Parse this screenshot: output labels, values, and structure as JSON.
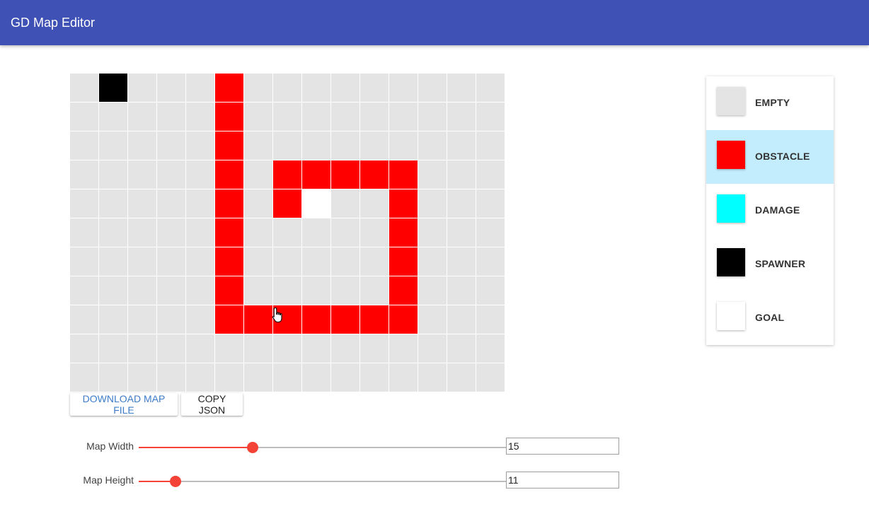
{
  "app": {
    "title": "GD Map Editor"
  },
  "tile_types": {
    "E": {
      "name": "EMPTY",
      "color": "#e4e4e4"
    },
    "O": {
      "name": "OBSTACLE",
      "color": "#ff0000"
    },
    "D": {
      "name": "DAMAGE",
      "color": "#00ffff"
    },
    "S": {
      "name": "SPAWNER",
      "color": "#000000"
    },
    "G": {
      "name": "GOAL",
      "color": "#ffffff"
    }
  },
  "map": {
    "width": 15,
    "height": 11,
    "rows": [
      "ESEEEOEEEEEEEEE",
      "EEEEEOEEEEEEEEE",
      "EEEEEOEEEEEEEEE",
      "EEEEEOEOOOOOEEE",
      "EEEEEOEOGEEOEEE",
      "EEEEEOEEEEEOEEE",
      "EEEEEOEEEEEOEEE",
      "EEEEEOEEEEEOEEE",
      "EEEEEOOOOOOOEEE",
      "EEEEEEEEEEEEEEE",
      "EEEEEEEEEEEEEEE"
    ]
  },
  "buttons": {
    "download_label": "DOWNLOAD MAP FILE",
    "copy_label": "COPY JSON"
  },
  "sliders": {
    "width": {
      "label": "Map Width",
      "value": "15",
      "level_fraction": 0.31
    },
    "height": {
      "label": "Map Height",
      "value": "11",
      "level_fraction": 0.1
    }
  },
  "palette": {
    "selected": "OBSTACLE",
    "selected_bg": "#c3ecfc",
    "items": [
      {
        "label": "EMPTY",
        "color": "#e4e4e4"
      },
      {
        "label": "OBSTACLE",
        "color": "#ff0000"
      },
      {
        "label": "DAMAGE",
        "color": "#00ffff"
      },
      {
        "label": "SPAWNER",
        "color": "#000000"
      },
      {
        "label": "GOAL",
        "color": "#ffffff"
      }
    ]
  },
  "colors": {
    "appbar": "#3f51b5",
    "slider_accent": "#f44336",
    "download_text": "#3d7cc9"
  },
  "icons": {
    "cursor": "hand-pointer-icon"
  }
}
